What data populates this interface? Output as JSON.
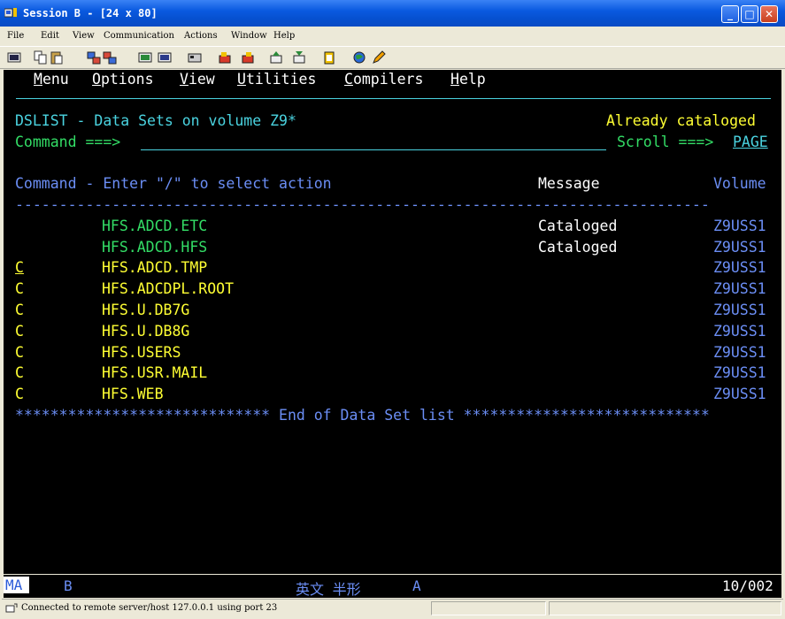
{
  "window": {
    "title": "Session B - [24 x 80]"
  },
  "menubar": {
    "items": [
      "File",
      "Edit",
      "View",
      "Communication",
      "Actions",
      "Window",
      "Help"
    ]
  },
  "ispf_menu": [
    "Menu",
    "Options",
    "View",
    "Utilities",
    "Compilers",
    "Help"
  ],
  "panel": {
    "title": "DSLIST - Data Sets on volume Z9*",
    "message": "Already cataloged",
    "command_label": "Command ===>",
    "command_value": "",
    "scroll_label": "Scroll ===>",
    "scroll_value": "PAGE",
    "header_command": "Command - Enter \"/\" to select action",
    "header_message": "Message",
    "header_volume": "Volume",
    "separator": "-------------------------------------------------------------------------------",
    "rows": [
      {
        "cmd": "",
        "dsname": "HFS.ADCD.ETC",
        "message": "Cataloged",
        "volume": "Z9USS1"
      },
      {
        "cmd": "",
        "dsname": "HFS.ADCD.HFS",
        "message": "Cataloged",
        "volume": "Z9USS1"
      },
      {
        "cmd": "C",
        "dsname": "HFS.ADCD.TMP",
        "message": "",
        "volume": "Z9USS1"
      },
      {
        "cmd": "C",
        "dsname": "HFS.ADCDPL.ROOT",
        "message": "",
        "volume": "Z9USS1"
      },
      {
        "cmd": "C",
        "dsname": "HFS.U.DB7G",
        "message": "",
        "volume": "Z9USS1"
      },
      {
        "cmd": "C",
        "dsname": "HFS.U.DB8G",
        "message": "",
        "volume": "Z9USS1"
      },
      {
        "cmd": "C",
        "dsname": "HFS.USERS",
        "message": "",
        "volume": "Z9USS1"
      },
      {
        "cmd": "C",
        "dsname": "HFS.USR.MAIL",
        "message": "",
        "volume": "Z9USS1"
      },
      {
        "cmd": "C",
        "dsname": "HFS.WEB",
        "message": "",
        "volume": "Z9USS1"
      }
    ],
    "end_line": "***************************** End of Data Set list ****************************"
  },
  "oia": {
    "ma": "MA",
    "session": "B",
    "ime": "英文 半形",
    "mode": "A",
    "cursor": "10/002"
  },
  "statusbar": {
    "message": "Connected to remote server/host 127.0.0.1 using port 23"
  },
  "icons": [
    "app-icon",
    "minimize-icon",
    "maximize-icon",
    "close-icon"
  ],
  "colors": {
    "screen_bg": "#000000",
    "cyan": "#4ad3e0",
    "green": "#33dd66",
    "yellow": "#ffff33",
    "blue": "#6b8ef5",
    "titlebar": "#0a5ae0"
  }
}
